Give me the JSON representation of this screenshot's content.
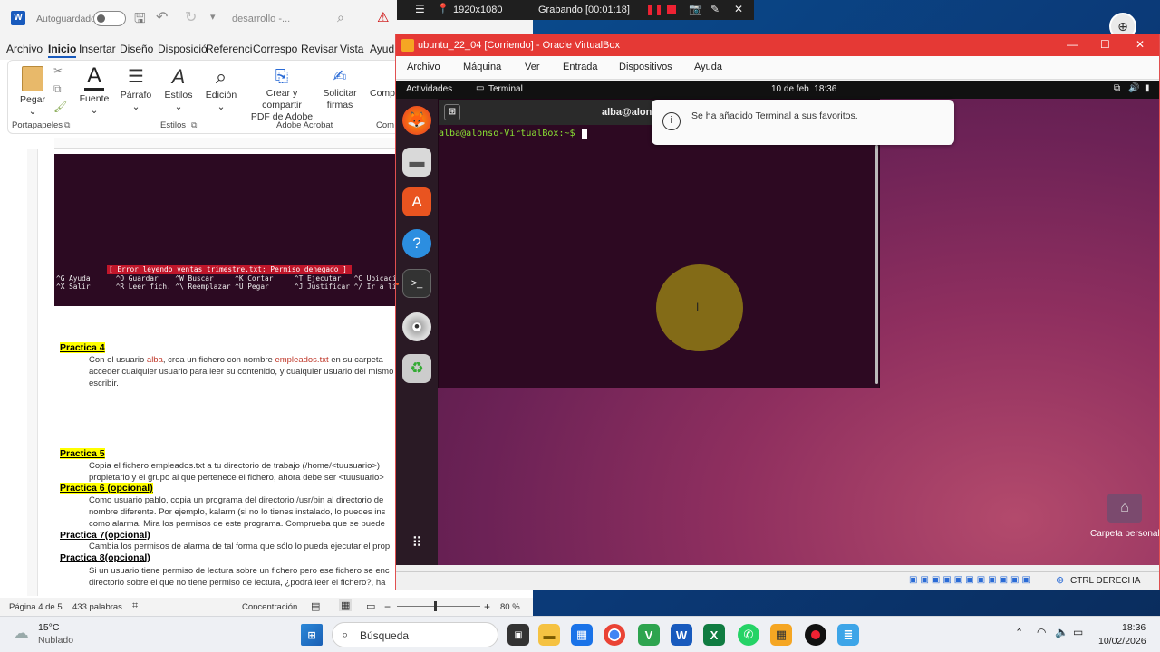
{
  "word": {
    "autosave_label": "Autoguardado",
    "doc_title": "desarrollo -...",
    "tabs": [
      "Archivo",
      "Inicio",
      "Insertar",
      "Diseño",
      "Disposició",
      "Referenci",
      "Correspo",
      "Revisar",
      "Vista",
      "Ayud"
    ],
    "ribbon": {
      "paste": "Pegar",
      "font": "Fuente",
      "paragraph": "Párrafo",
      "styles": "Estilos",
      "editing": "Edición",
      "create_pdf_line1": "Crear y compartir",
      "create_pdf_line2": "PDF de Adobe",
      "request_sign_line1": "Solicitar",
      "request_sign_line2": "firmas",
      "comp": "Comp",
      "group_clipboard": "Portapapeles",
      "group_styles": "Estilos",
      "group_acrobat": "Adobe Acrobat",
      "group_comp": "Com"
    },
    "nano": {
      "error": "[ Error leyendo ventas_trimestre.txt: Permiso denegado ]",
      "row1": "^G Ayuda      ^O Guardar    ^W Buscar     ^K Cortar     ^T Ejecutar   ^C Ubicación",
      "row2": "^X Salir      ^R Leer fich. ^\\ Reemplazar ^U Pegar      ^J Justificar ^/ Ir a línea"
    },
    "doc": {
      "p4_title": "Practica 4",
      "p4_l1_a": "Con el usuario ",
      "p4_l1_user": "alba",
      "p4_l1_b": ", crea un fichero con nombre ",
      "p4_l1_file": "empleados.txt",
      "p4_l1_c": " en su carpeta",
      "p4_l2": "acceder cualquier usuario para leer su contenido, y cualquier usuario del mismo",
      "p4_l3": "escribir.",
      "p5_title": "Practica 5",
      "p5_l1": " Copia el fichero empleados.txt  a tu directorio de trabajo (/home/<tuusuario>)",
      "p5_l2": "propietario y el grupo al que pertenece el fichero, ahora debe ser <tuusuario>",
      "p6_title": "Practica 6 (opcional)",
      "p6_l1": "Como usuario pablo, copia un programa del directorio /usr/bin al directorio de",
      "p6_l2": "nombre diferente. Por ejemplo, kalarm (si no lo tienes instalado, lo puedes ins",
      "p6_l3": "como alarma. Mira los permisos de este programa. Comprueba que se puede",
      "p7_title": "Practica 7(opcional)",
      "p7_l1": "Cambia los permisos de alarma de tal forma que sólo lo pueda ejecutar el prop",
      "p8_title": "Practica 8(opcional)",
      "p8_l1": "Si un usuario tiene permiso de lectura sobre un fichero pero ese fichero se enc",
      "p8_l2": "directorio sobre el que no tiene permiso de lectura, ¿podrá leer el fichero?, ha"
    },
    "status": {
      "page": "Página 4 de 5",
      "words": "433 palabras",
      "focus": "Concentración",
      "zoom": "80 %"
    }
  },
  "recorder": {
    "resolution": "1920x1080",
    "status": "Grabando [00:01:18]"
  },
  "vbox": {
    "title": "ubuntu_22_04 [Corriendo] - Oracle VirtualBox",
    "menu": [
      "Archivo",
      "Máquina",
      "Ver",
      "Entrada",
      "Dispositivos",
      "Ayuda"
    ],
    "host_key": "CTRL DERECHA"
  },
  "ubuntu": {
    "activities": "Actividades",
    "app_name": "Terminal",
    "clock": "10 de feb  18:36",
    "terminal_title": "alba@alons",
    "prompt": "alba@alonso-VirtualBox:~$",
    "notification": "Se ha añadido Terminal a sus favoritos.",
    "home_folder": "Carpeta personal"
  },
  "taskbar": {
    "weather_temp": "15°C",
    "weather_desc": "Nublado",
    "search_placeholder": "Búsqueda",
    "time": "18:36",
    "date": "10/02/2026"
  }
}
